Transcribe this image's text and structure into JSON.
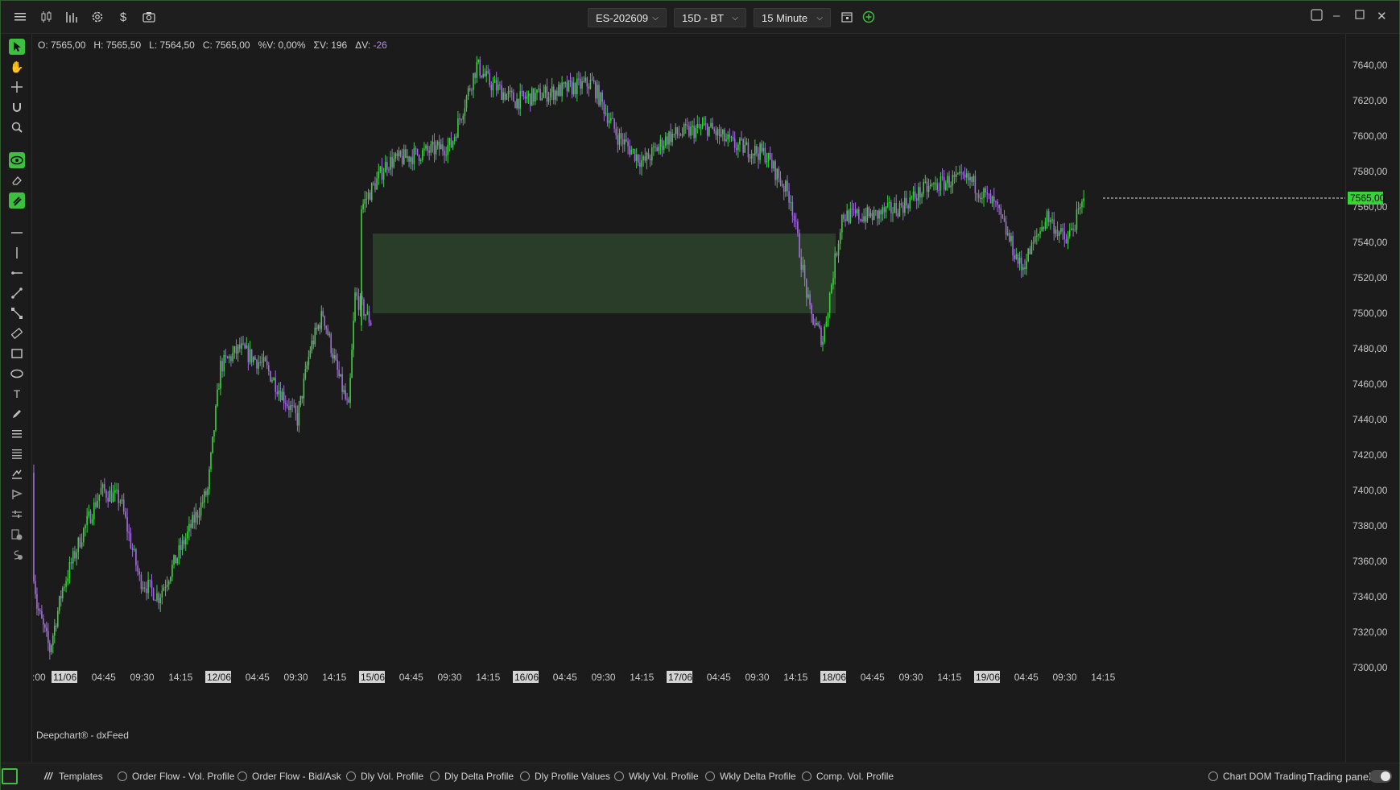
{
  "toolbar": {
    "icons": [
      "menu-icon",
      "candlestick-icon",
      "bar-chart-icon",
      "settings-icon",
      "dollar-icon",
      "camera-icon"
    ],
    "symbol": "ES-202609",
    "range": "15D - BT",
    "timeframe": "15 Minute"
  },
  "ohlc": {
    "o": "O: 7565,00",
    "h": "H: 7565,50",
    "l": "L: 7564,50",
    "c": "C: 7565,00",
    "vpct": "%V: 0,00%",
    "sv": "ΣV: 196",
    "dv_label": "ΔV:",
    "dv_value": "-26"
  },
  "credit": "Deepchart® - dxFeed",
  "price_axis": {
    "ticks": [
      "7640,00",
      "7620,00",
      "7600,00",
      "7580,00",
      "7560,00",
      "7540,00",
      "7520,00",
      "7500,00",
      "7480,00",
      "7460,00",
      "7440,00",
      "7420,00",
      "7400,00",
      "7380,00",
      "7360,00",
      "7340,00",
      "7320,00",
      "7300,00"
    ],
    "current_price": "7565,00"
  },
  "time_axis": [
    {
      "label": ":00",
      "date": false
    },
    {
      "label": "11/06",
      "date": true
    },
    {
      "label": "04:45",
      "date": false
    },
    {
      "label": "09:30",
      "date": false
    },
    {
      "label": "14:15",
      "date": false
    },
    {
      "label": "12/06",
      "date": true
    },
    {
      "label": "04:45",
      "date": false
    },
    {
      "label": "09:30",
      "date": false
    },
    {
      "label": "14:15",
      "date": false
    },
    {
      "label": "15/06",
      "date": true
    },
    {
      "label": "04:45",
      "date": false
    },
    {
      "label": "09:30",
      "date": false
    },
    {
      "label": "14:15",
      "date": false
    },
    {
      "label": "16/06",
      "date": true
    },
    {
      "label": "04:45",
      "date": false
    },
    {
      "label": "09:30",
      "date": false
    },
    {
      "label": "14:15",
      "date": false
    },
    {
      "label": "17/06",
      "date": true
    },
    {
      "label": "04:45",
      "date": false
    },
    {
      "label": "09:30",
      "date": false
    },
    {
      "label": "14:15",
      "date": false
    },
    {
      "label": "18/06",
      "date": true
    },
    {
      "label": "04:45",
      "date": false
    },
    {
      "label": "09:30",
      "date": false
    },
    {
      "label": "14:15",
      "date": false
    },
    {
      "label": "19/06",
      "date": true
    },
    {
      "label": "04:45",
      "date": false
    },
    {
      "label": "09:30",
      "date": false
    },
    {
      "label": "14:15",
      "date": false
    }
  ],
  "chart_data": {
    "type": "candlestick",
    "interval": "15 Minute",
    "y_range": [
      7300,
      7650
    ],
    "up_color": "#39d239",
    "down_color": "#a46bdf",
    "zone": {
      "from_date": "15/06",
      "to_date": "18/06",
      "price_low": 7500,
      "price_high": 7545,
      "color": "#2a3f2a"
    },
    "close_path": [
      {
        "t": "11/06 00:00",
        "close": 7410
      },
      {
        "t": "11/06 02:00",
        "close": 7335
      },
      {
        "t": "11/06 04:00",
        "close": 7310
      },
      {
        "t": "11/06 06:00",
        "close": 7345
      },
      {
        "t": "11/06 09:00",
        "close": 7375
      },
      {
        "t": "11/06 12:00",
        "close": 7400
      },
      {
        "t": "11/06 15:00",
        "close": 7395
      },
      {
        "t": "11/06 18:00",
        "close": 7350
      },
      {
        "t": "11/06 21:00",
        "close": 7340
      },
      {
        "t": "12/06 00:00",
        "close": 7400
      },
      {
        "t": "12/06 02:00",
        "close": 7470
      },
      {
        "t": "12/06 05:00",
        "close": 7480
      },
      {
        "t": "12/06 09:00",
        "close": 7470
      },
      {
        "t": "12/06 14:00",
        "close": 7440
      },
      {
        "t": "12/06 16:00",
        "close": 7480
      },
      {
        "t": "12/06 18:00",
        "close": 7500
      },
      {
        "t": "12/06 20:00",
        "close": 7470
      },
      {
        "t": "12/06 22:00",
        "close": 7445
      },
      {
        "t": "12/06 23:00",
        "close": 7510
      },
      {
        "t": "13/06 02:00",
        "close": 7495
      },
      {
        "t": "15/06 00:00",
        "close": 7560
      },
      {
        "t": "15/06 04:00",
        "close": 7585
      },
      {
        "t": "15/06 09:00",
        "close": 7590
      },
      {
        "t": "15/06 14:00",
        "close": 7595
      },
      {
        "t": "15/06 18:00",
        "close": 7640
      },
      {
        "t": "15/06 20:00",
        "close": 7630
      },
      {
        "t": "16/06 00:00",
        "close": 7620
      },
      {
        "t": "16/06 06:00",
        "close": 7625
      },
      {
        "t": "16/06 12:00",
        "close": 7630
      },
      {
        "t": "16/06 16:00",
        "close": 7600
      },
      {
        "t": "16/06 20:00",
        "close": 7585
      },
      {
        "t": "17/06 00:00",
        "close": 7600
      },
      {
        "t": "17/06 06:00",
        "close": 7605
      },
      {
        "t": "17/06 10:00",
        "close": 7595
      },
      {
        "t": "17/06 15:00",
        "close": 7590
      },
      {
        "t": "17/06 19:00",
        "close": 7565
      },
      {
        "t": "17/06 22:00",
        "close": 7500
      },
      {
        "t": "18/06 00:00",
        "close": 7485
      },
      {
        "t": "18/06 03:00",
        "close": 7555
      },
      {
        "t": "18/06 08:00",
        "close": 7555
      },
      {
        "t": "18/06 12:00",
        "close": 7560
      },
      {
        "t": "18/06 16:00",
        "close": 7570
      },
      {
        "t": "18/06 20:00",
        "close": 7575
      },
      {
        "t": "18/06 23:00",
        "close": 7575
      },
      {
        "t": "19/06 03:00",
        "close": 7560
      },
      {
        "t": "19/06 07:00",
        "close": 7525
      },
      {
        "t": "19/06 11:00",
        "close": 7555
      },
      {
        "t": "19/06 14:00",
        "close": 7540
      },
      {
        "t": "19/06 17:00",
        "close": 7565
      }
    ]
  },
  "bottombar": {
    "templates_label": "Templates",
    "items": [
      "Order Flow - Vol. Profile",
      "Order Flow - Bid/Ask",
      "Dly Vol. Profile",
      "Dly Delta Profile",
      "Dly Profile Values",
      "Wkly Vol. Profile",
      "Wkly Delta Profile",
      "Comp. Vol. Profile"
    ],
    "chart_dom": "Chart DOM Trading",
    "trading_panel": "Trading panel"
  }
}
